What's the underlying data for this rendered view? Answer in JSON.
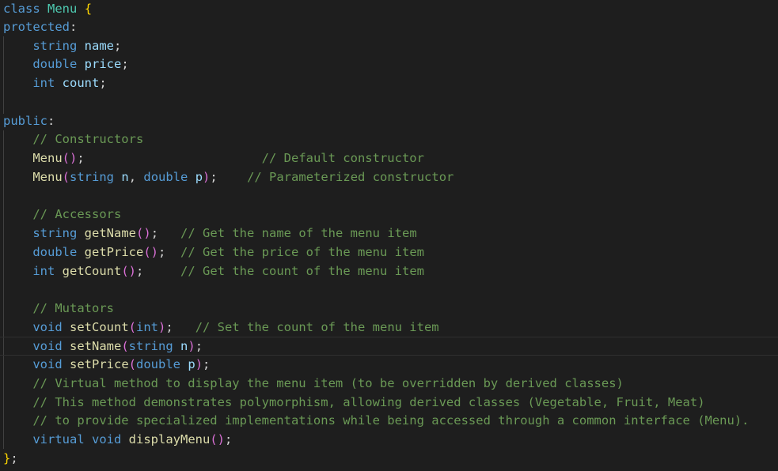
{
  "colors": {
    "background": "#1e1e1e",
    "keyword": "#569cd6",
    "class_name": "#4ec9b0",
    "function": "#dcdcaa",
    "variable": "#9cdcfe",
    "comment": "#6a9955",
    "bracket_level1": "#ffd700",
    "bracket_level2": "#da70d6",
    "text": "#d4d4d4"
  },
  "code": {
    "l01": {
      "kw": "class",
      "name": "Menu",
      "brace": "{"
    },
    "l02": {
      "kw": "protected",
      "colon": ":"
    },
    "l03": {
      "indent": "    ",
      "type": "string",
      "var": "name",
      "semi": ";"
    },
    "l04": {
      "indent": "    ",
      "type": "double",
      "var": "price",
      "semi": ";"
    },
    "l05": {
      "indent": "    ",
      "type": "int",
      "var": "count",
      "semi": ";"
    },
    "l07": {
      "kw": "public",
      "colon": ":"
    },
    "l08": {
      "indent": "    ",
      "comment": "// Constructors"
    },
    "l09": {
      "indent": "    ",
      "fn": "Menu",
      "open": "(",
      "close": ")",
      "semi": ";",
      "pad": "                        ",
      "comment": "// Default constructor"
    },
    "l10": {
      "indent": "    ",
      "fn": "Menu",
      "open": "(",
      "t1": "string",
      "p1": "n",
      "comma": ", ",
      "t2": "double",
      "p2": "p",
      "close": ")",
      "semi": ";",
      "pad": "    ",
      "comment": "// Parameterized constructor"
    },
    "l12": {
      "indent": "    ",
      "comment": "// Accessors"
    },
    "l13": {
      "indent": "    ",
      "type": "string",
      "fn": "getName",
      "open": "(",
      "close": ")",
      "semi": ";",
      "pad": "   ",
      "comment": "// Get the name of the menu item"
    },
    "l14": {
      "indent": "    ",
      "type": "double",
      "fn": "getPrice",
      "open": "(",
      "close": ")",
      "semi": ";",
      "pad": "  ",
      "comment": "// Get the price of the menu item"
    },
    "l15": {
      "indent": "    ",
      "type": "int",
      "fn": "getCount",
      "open": "(",
      "close": ")",
      "semi": ";",
      "pad": "     ",
      "comment": "// Get the count of the menu item"
    },
    "l17": {
      "indent": "    ",
      "comment": "// Mutators"
    },
    "l18": {
      "indent": "    ",
      "type": "void",
      "fn": "setCount",
      "open": "(",
      "t1": "int",
      "close": ")",
      "semi": ";",
      "pad": "   ",
      "comment": "// Set the count of the menu item"
    },
    "l19": {
      "indent": "    ",
      "type": "void",
      "fn": "setName",
      "open": "(",
      "t1": "string",
      "p1": "n",
      "close": ")",
      "semi": ";"
    },
    "l20": {
      "indent": "    ",
      "type": "void",
      "fn": "setPrice",
      "open": "(",
      "t1": "double",
      "p1": "p",
      "close": ")",
      "semi": ";"
    },
    "l21": {
      "indent": "    ",
      "comment": "// Virtual method to display the menu item (to be overridden by derived classes)"
    },
    "l22": {
      "indent": "    ",
      "comment": "// This method demonstrates polymorphism, allowing derived classes (Vegetable, Fruit, Meat)"
    },
    "l23": {
      "indent": "    ",
      "comment": "// to provide specialized implementations while being accessed through a common interface (Menu)."
    },
    "l24": {
      "indent": "    ",
      "kw": "virtual",
      "type": "void",
      "fn": "displayMenu",
      "open": "(",
      "close": ")",
      "semi": ";"
    },
    "l25": {
      "brace": "}",
      "semi": ";"
    }
  }
}
